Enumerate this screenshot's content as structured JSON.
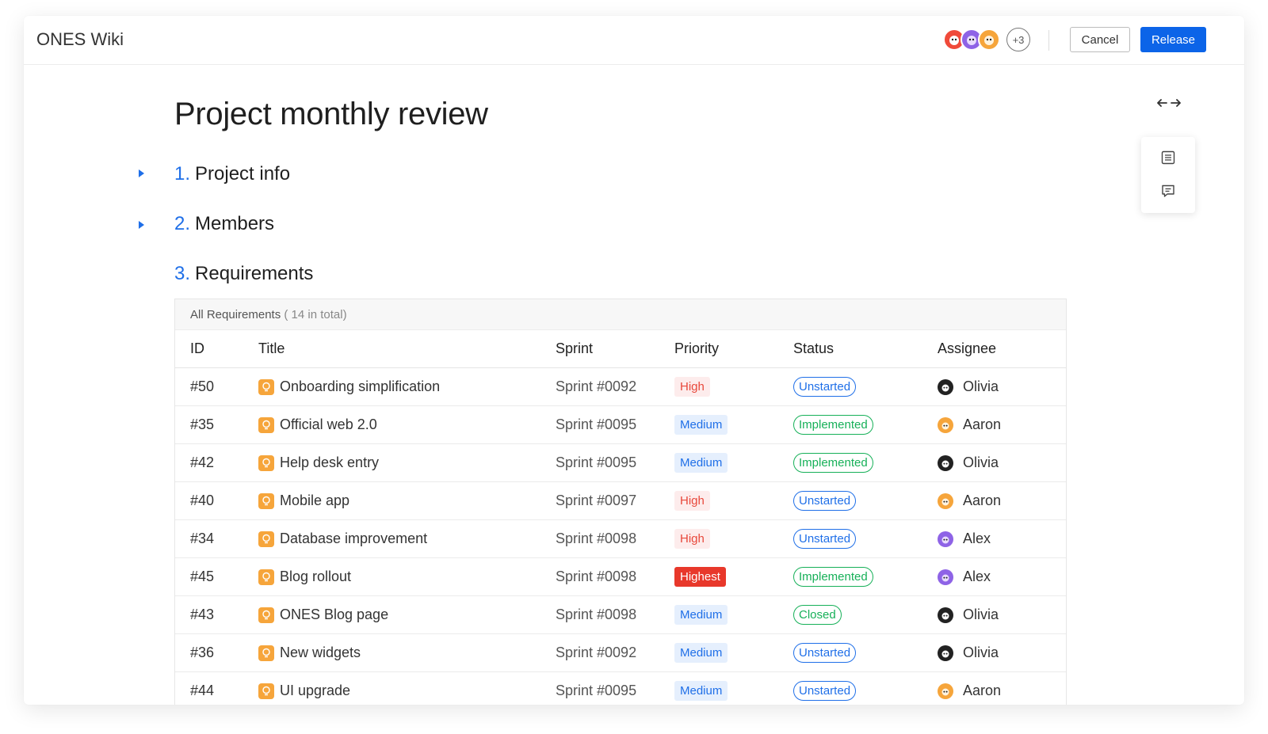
{
  "app": {
    "title": "ONES Wiki"
  },
  "header": {
    "collaborators_more": "+3",
    "cancel_label": "Cancel",
    "release_label": "Release"
  },
  "page": {
    "title": "Project monthly review",
    "sections": [
      {
        "number": "1.",
        "label": "Project info",
        "collapsible": true
      },
      {
        "number": "2.",
        "label": "Members",
        "collapsible": true
      },
      {
        "number": "3.",
        "label": "Requirements",
        "collapsible": false
      }
    ]
  },
  "table": {
    "caption": "All Requirements",
    "total": "( 14 in total)",
    "columns": [
      "ID",
      "Title",
      "Sprint",
      "Priority",
      "Status",
      "Assignee"
    ],
    "rows": [
      {
        "id": "#50",
        "title": "Onboarding simplification",
        "sprint": "Sprint #0092",
        "priority": "High",
        "status": "Unstarted",
        "assignee": "Olivia"
      },
      {
        "id": "#35",
        "title": "Official web 2.0",
        "sprint": "Sprint #0095",
        "priority": "Medium",
        "status": "Implemented",
        "assignee": "Aaron"
      },
      {
        "id": "#42",
        "title": "Help desk entry",
        "sprint": "Sprint #0095",
        "priority": "Medium",
        "status": "Implemented",
        "assignee": "Olivia"
      },
      {
        "id": "#40",
        "title": "Mobile app",
        "sprint": "Sprint #0097",
        "priority": "High",
        "status": "Unstarted",
        "assignee": "Aaron"
      },
      {
        "id": "#34",
        "title": "Database improvement",
        "sprint": "Sprint #0098",
        "priority": "High",
        "status": "Unstarted",
        "assignee": "Alex"
      },
      {
        "id": "#45",
        "title": "Blog rollout",
        "sprint": "Sprint #0098",
        "priority": "Highest",
        "status": "Implemented",
        "assignee": "Alex"
      },
      {
        "id": "#43",
        "title": "ONES Blog page",
        "sprint": "Sprint #0098",
        "priority": "Medium",
        "status": "Closed",
        "assignee": "Olivia"
      },
      {
        "id": "#36",
        "title": "New widgets",
        "sprint": "Sprint #0092",
        "priority": "Medium",
        "status": "Unstarted",
        "assignee": "Olivia"
      },
      {
        "id": "#44",
        "title": "UI upgrade",
        "sprint": "Sprint #0095",
        "priority": "Medium",
        "status": "Unstarted",
        "assignee": "Aaron"
      }
    ]
  },
  "colors": {
    "accent": "#0c64e8",
    "requirement_icon": "#f6a53b",
    "priority_high": "#e8483b",
    "priority_medium": "#1f6fe8",
    "status_unstarted": "#1f6fe8",
    "status_implemented": "#16b058"
  },
  "icons": {
    "width_toggle": "arrows-horizontal-icon",
    "outline": "outline-list-icon",
    "comments": "comment-icon",
    "requirement": "lightbulb-icon",
    "section_toggle": "caret-right-icon"
  }
}
